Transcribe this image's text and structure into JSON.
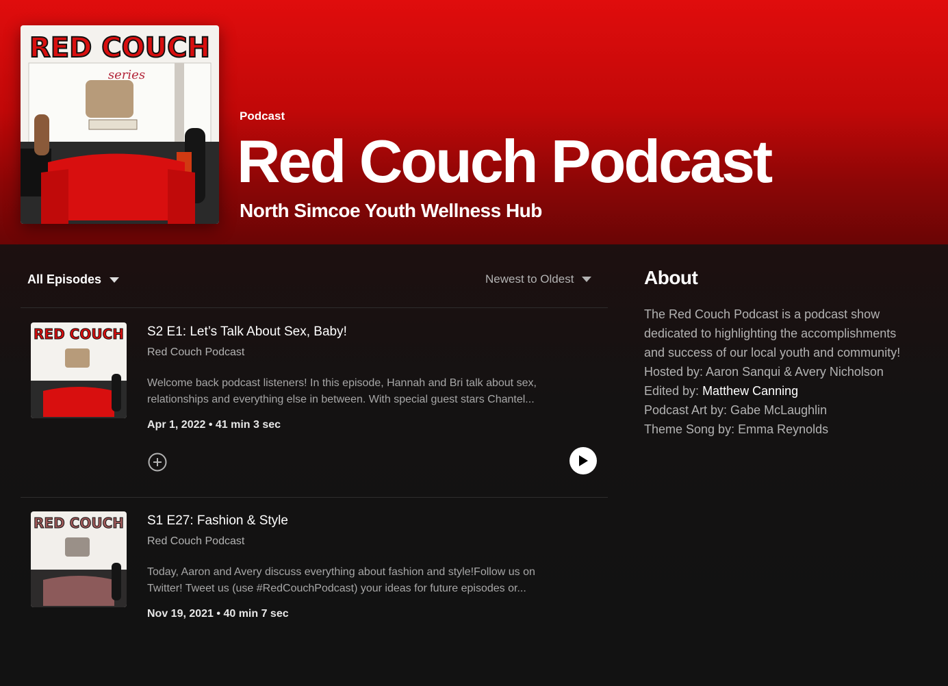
{
  "header": {
    "type_label": "Podcast",
    "title": "Red Couch Podcast",
    "publisher": "North Simcoe Youth Wellness Hub",
    "cover_logo_text": "RED COUCH",
    "cover_sub_text": "series"
  },
  "episodes_toolbar": {
    "filter_label": "All Episodes",
    "sort_label": "Newest to Oldest"
  },
  "episodes": [
    {
      "title": "S2 E1: Let’s Talk About Sex, Baby!",
      "show": "Red Couch Podcast",
      "desc_line1": "Welcome back podcast listeners! In this episode, Hannah and Bri talk about sex,",
      "desc_line2": "relationships and everything else in between. With special guest stars Chantel...",
      "meta": "Apr 1, 2022 • 41 min 3 sec"
    },
    {
      "title": "S1 E27: Fashion & Style",
      "show": "Red Couch Podcast",
      "desc_line1": "Today, Aaron and Avery discuss everything about fashion and style!Follow us on",
      "desc_line2": "Twitter! Tweet us (use #RedCouchPodcast) your ideas for future episodes or...",
      "meta": "Nov 19, 2021 • 40 min 7 sec"
    }
  ],
  "about": {
    "heading": "About",
    "line1": "The Red Couch Podcast is a podcast show",
    "line2": "dedicated to highlighting the accomplishments",
    "line3": "and success of our local youth and community!",
    "line4": "Hosted by: Aaron Sanqui & Avery Nicholson",
    "line5_label": "Edited by: ",
    "line5_name": "Matthew Canning",
    "line6": "Podcast Art by: Gabe McLaughlin",
    "line7": "Theme Song by: Emma Reynolds"
  },
  "colors": {
    "header_red": "#e00d0d",
    "background": "#121212",
    "secondary_text": "#b3b3b3"
  },
  "icons": [
    "chevron-down-icon",
    "add-circle-icon",
    "play-icon"
  ]
}
